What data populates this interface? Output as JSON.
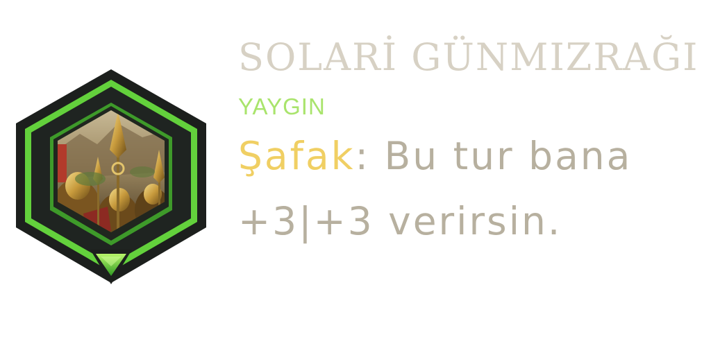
{
  "card": {
    "name": "SOLARİ GÜNMIZRAĞI",
    "rarity": "YAYGIN",
    "ability": {
      "keyword": "Şafak",
      "text_line1": ": Bu tur bana",
      "text_line2": "+3|+3 verirsin."
    },
    "art_icon": "solari-spear-soldiers-art",
    "rarity_icon": "green-triangle-gem-icon"
  },
  "colors": {
    "name": "#d7d1c4",
    "rarity": "#a9e46c",
    "keyword": "#f0cf63",
    "ability_text": "#b7b09f",
    "frame_outer": "#1c1f1d",
    "frame_green": "#63d13c"
  }
}
